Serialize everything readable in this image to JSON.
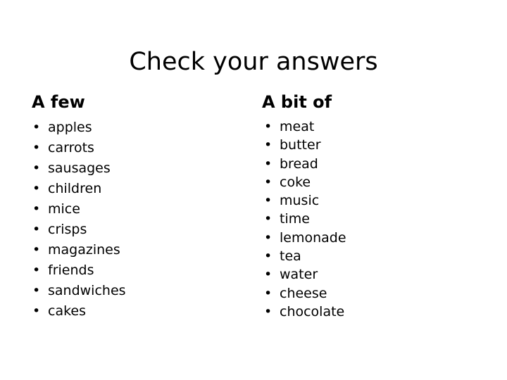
{
  "slide": {
    "title": "Check your answers",
    "background_color": "#ffffff",
    "text_color": "#000000",
    "bullet_glyph": "•",
    "columns": [
      {
        "heading": "A few",
        "items": [
          "apples",
          "carrots",
          "sausages",
          "children",
          "mice",
          "crisps",
          "magazines",
          "friends",
          "sandwiches",
          "cakes"
        ]
      },
      {
        "heading": "A bit of",
        "items": [
          "meat",
          "butter",
          "bread",
          "coke",
          "music",
          "time",
          "lemonade",
          "tea",
          "water",
          "cheese",
          "chocolate"
        ]
      }
    ]
  }
}
